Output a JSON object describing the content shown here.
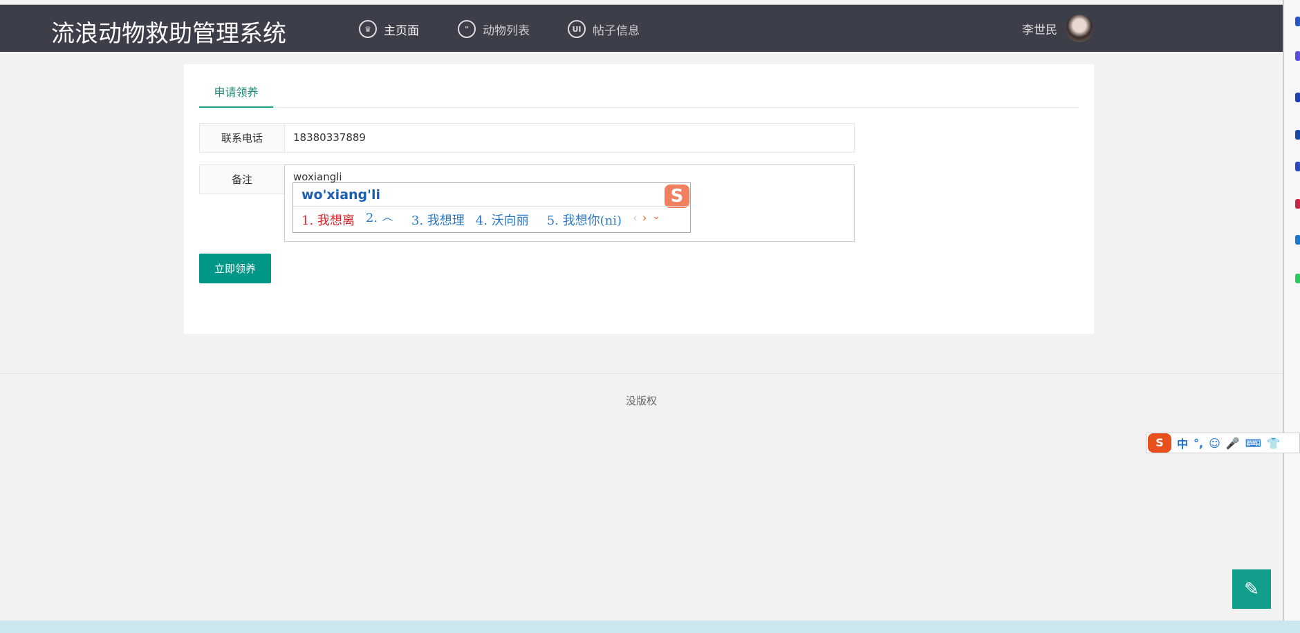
{
  "header": {
    "title": "流浪动物救助管理系统",
    "nav": [
      {
        "label": "主页面",
        "icon": "crown-icon"
      },
      {
        "label": "动物列表",
        "icon": "chat-icon"
      },
      {
        "label": "帖子信息",
        "icon": "ui-icon"
      }
    ],
    "user": "李世民"
  },
  "tab": "申请领养",
  "form": {
    "phone_label": "联系电话",
    "phone_value": "18380337889",
    "note_label": "备注",
    "note_value": "woxiangli",
    "submit": "立即领养"
  },
  "ime": {
    "pinyin": "wo'xiang'li",
    "candidates": [
      "1. 我想离",
      "2. ෴",
      "3. 我想理",
      "4. 沃向丽",
      "5. 我想你(ni)"
    ],
    "logo": "S",
    "toolbar": [
      "中",
      "°,",
      "☺",
      "🎤",
      "⌨",
      "👕"
    ]
  },
  "footer": "没版权",
  "colors": {
    "header": "#3c3f4a",
    "accent": "#009688"
  }
}
